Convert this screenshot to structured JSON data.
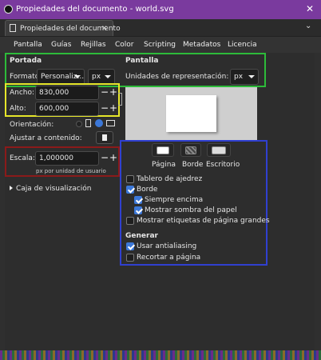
{
  "window": {
    "title": "Propiedades del documento - world.svg"
  },
  "tab": {
    "label": "Propiedades del documento"
  },
  "menu": [
    "Pantalla",
    "Guías",
    "Rejillas",
    "Color",
    "Scripting",
    "Metadatos",
    "Licencia"
  ],
  "portada": {
    "heading": "Portada",
    "formato_label": "Formato:",
    "formato_value": "Personaliz...",
    "unit_value": "px",
    "ancho_label": "Ancho:",
    "ancho_value": "830,000",
    "alto_label": "Alto:",
    "alto_value": "600,000",
    "orientacion_label": "Orientación:",
    "ajustar_label": "Ajustar a contenido:",
    "escala_label": "Escala:",
    "escala_value": "1,000000",
    "escala_hint": "px por unidad de usuario",
    "caja_label": "Caja de visualización"
  },
  "pantalla": {
    "heading": "Pantalla",
    "unidades_label": "Unidades de representación:",
    "unidades_value": "px",
    "swatches": [
      {
        "label": "Página",
        "color": "#ffffff"
      },
      {
        "label": "Borde",
        "color": "#555555"
      },
      {
        "label": "Escritorio",
        "color": "#dcdcdc"
      }
    ],
    "checks": [
      {
        "label": "Tablero de ajedrez",
        "checked": false
      },
      {
        "label": "Borde",
        "checked": true
      },
      {
        "label": "Siempre encima",
        "checked": true
      },
      {
        "label": "Mostrar sombra del papel",
        "checked": true
      },
      {
        "label": "Mostrar etiquetas de página grandes",
        "checked": false
      }
    ],
    "generar_heading": "Generar",
    "generar_checks": [
      {
        "label": "Usar antialiasing",
        "checked": true
      },
      {
        "label": "Recortar a página",
        "checked": false
      }
    ]
  },
  "colors": {
    "titlebar": "#7a3a9e",
    "accent": "#3c78d8"
  }
}
